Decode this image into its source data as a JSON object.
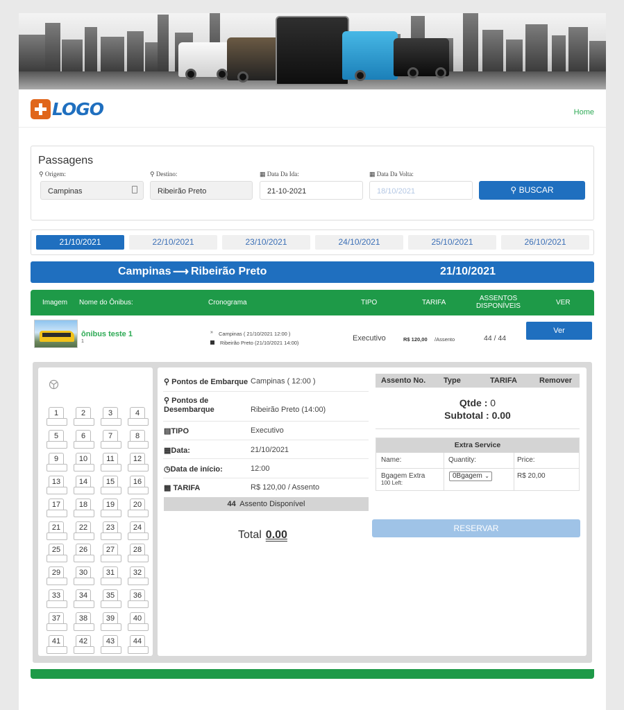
{
  "header": {
    "logo_text": "LOGO",
    "nav_home": "Home"
  },
  "search": {
    "title": "Passagens",
    "origem_label": "Origem:",
    "destino_label": "Destino:",
    "ida_label": "Data Da Ida:",
    "volta_label": "Data Da Volta:",
    "origem_value": "Campinas",
    "destino_value": "Ribeirão Preto",
    "ida_value": "21-10-2021",
    "volta_placeholder": "18/10/2021",
    "button_label": "BUSCAR"
  },
  "date_tabs": [
    "21/10/2021",
    "22/10/2021",
    "23/10/2021",
    "24/10/2021",
    "25/10/2021",
    "26/10/2021"
  ],
  "route": {
    "from": "Campinas",
    "to": "Ribeirão Preto",
    "date": "21/10/2021"
  },
  "table": {
    "headers": {
      "imagem": "Imagem",
      "nome": "Nome do Ônibus:",
      "cronograma": "Cronograma",
      "tipo": "TIPO",
      "tarifa": "TARIFA",
      "assentos": "ASSENTOS DISPONÍVEIS",
      "ver": "VER"
    },
    "row": {
      "bus_name": "ônibus teste 1",
      "bus_sub": "1",
      "stop1": "Campinas ( 21/10/2021 12:00 )",
      "stop2": "Ribeirão Preto (21/10/2021 14:00)",
      "tipo": "Executivo",
      "tarifa": "R$ 120,00",
      "tarifa_unit": "/Assento",
      "seats": "44 / 44",
      "ver_label": "Ver"
    }
  },
  "seats": [
    "1",
    "2",
    "3",
    "4",
    "5",
    "6",
    "7",
    "8",
    "9",
    "10",
    "11",
    "12",
    "13",
    "14",
    "15",
    "16",
    "17",
    "18",
    "19",
    "20",
    "21",
    "22",
    "23",
    "24",
    "25",
    "26",
    "27",
    "28",
    "29",
    "30",
    "31",
    "32",
    "33",
    "34",
    "35",
    "36",
    "37",
    "38",
    "39",
    "40",
    "41",
    "42",
    "43",
    "44"
  ],
  "details": {
    "embarque_label": "Pontos de Embarque",
    "embarque_value": "Campinas ( 12:00 )",
    "desembarque_label": "Pontos de Desembarque",
    "desembarque_value": "Ribeirão Preto (14:00)",
    "tipo_label": "TIPO",
    "tipo_value": "Executivo",
    "data_label": "Data:",
    "data_value": "21/10/2021",
    "inicio_label": "Data de início:",
    "inicio_value": "12:00",
    "tarifa_label": "TARIFA",
    "tarifa_value": "R$ 120,00  / Assento",
    "avail_count": "44",
    "avail_text": "Assento Disponível",
    "total_label": "Total",
    "total_value": "0.00"
  },
  "cart": {
    "col_assento": "Assento No.",
    "col_type": "Type",
    "col_tarifa": "TARIFA",
    "col_remover": "Remover",
    "qtde_label": "Qtde :",
    "qtde_value": "0",
    "subtotal_label": "Subtotal :",
    "subtotal_value": "0.00",
    "extra_title": "Extra Service",
    "name_label": "Name:",
    "quantity_label": "Quantity:",
    "price_label": "Price:",
    "item_name": "Bgagem Extra",
    "item_left": "100 Left:",
    "item_select": "0Bgagem",
    "item_price": "R$ 20,00",
    "reservar_label": "RESERVAR"
  },
  "colors": {
    "primary": "#1f6fbf",
    "green": "#1e9a48",
    "logo_orange": "#e0661b"
  }
}
